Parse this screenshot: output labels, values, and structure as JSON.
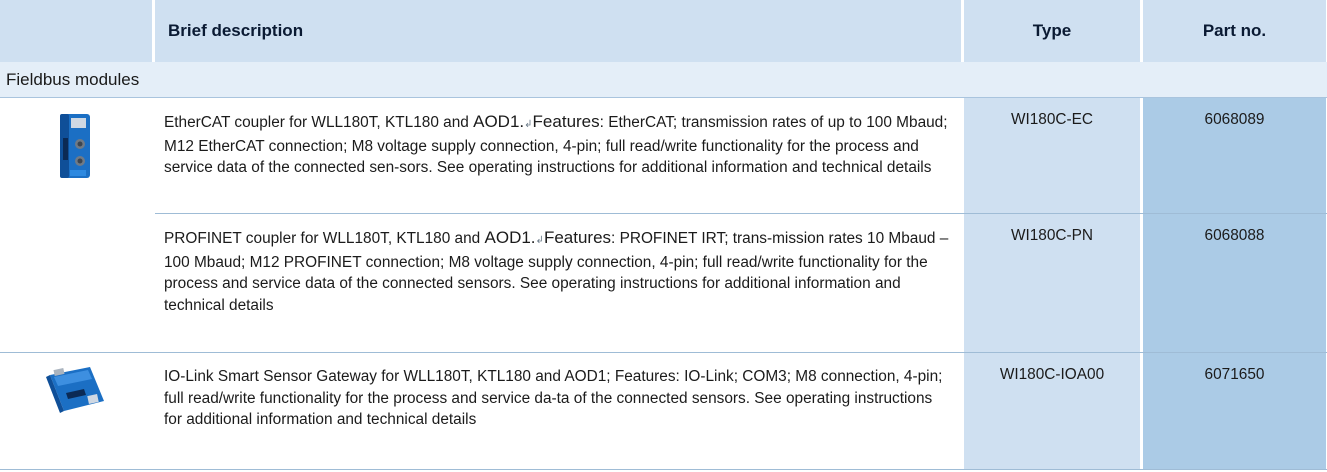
{
  "header": {
    "description": "Brief description",
    "type": "Type",
    "part_no": "Part no."
  },
  "section": {
    "title": "Fieldbus modules"
  },
  "rows": [
    {
      "desc_pre": "EtherCAT coupler for WLL180T, KTL180 and ",
      "desc_mid": "AOD1.",
      "desc_feat": "Features",
      "desc_post": ": EtherCAT; transmission rates of up to 100 Mbaud; M12 EtherCAT connection; M8 voltage supply connection, 4-pin; full read/write functionality for the process and service data of the connected sen-sors. See operating instructions for additional information and technical details",
      "type": "WI180C-EC",
      "part_no": "6068089"
    },
    {
      "desc_pre": "PROFINET coupler for WLL180T, KTL180 and ",
      "desc_mid": "AOD1.",
      "desc_feat": "Features",
      "desc_post": ": PROFINET IRT; trans-mission rates 10 Mbaud – 100 Mbaud; M12 PROFINET connection; M8 voltage supply connection, 4-pin; full read/write functionality for the process and service data of the connected sensors. See operating instructions for additional information and technical details",
      "type": "WI180C-PN",
      "part_no": "6068088"
    },
    {
      "desc": "IO-Link Smart Sensor Gateway for WLL180T, KTL180 and AOD1; Features: IO-Link; COM3; M8 connection, 4-pin; full read/write functionality for the process and service da-ta of the connected sensors. See operating instructions for additional information and technical details",
      "type": "WI180C-IOA00",
      "part_no": "6071650"
    }
  ]
}
